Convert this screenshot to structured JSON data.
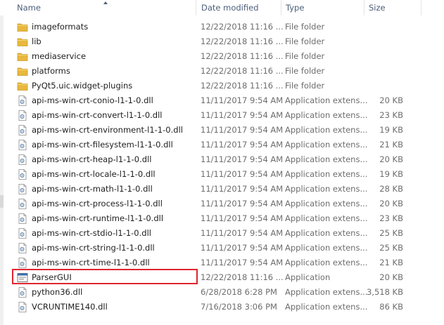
{
  "columns": {
    "name": "Name",
    "date": "Date modified",
    "type": "Type",
    "size": "Size"
  },
  "accent_colors": {
    "header_text": "#4c607a",
    "folder": "#e8b83e",
    "highlight_box": "#e0252f"
  },
  "files": [
    {
      "name": "imageformats",
      "date": "12/22/2018 11:16 ...",
      "type": "File folder",
      "size": "",
      "icon": "folder-icon"
    },
    {
      "name": "lib",
      "date": "12/22/2018 11:16 ...",
      "type": "File folder",
      "size": "",
      "icon": "folder-icon"
    },
    {
      "name": "mediaservice",
      "date": "12/22/2018 11:16 ...",
      "type": "File folder",
      "size": "",
      "icon": "folder-icon"
    },
    {
      "name": "platforms",
      "date": "12/22/2018 11:16 ...",
      "type": "File folder",
      "size": "",
      "icon": "folder-icon"
    },
    {
      "name": "PyQt5.uic.widget-plugins",
      "date": "12/22/2018 11:16 ...",
      "type": "File folder",
      "size": "",
      "icon": "folder-icon"
    },
    {
      "name": "api-ms-win-crt-conio-l1-1-0.dll",
      "date": "11/11/2017 9:54 AM",
      "type": "Application extens...",
      "size": "20 KB",
      "icon": "dll-icon"
    },
    {
      "name": "api-ms-win-crt-convert-l1-1-0.dll",
      "date": "11/11/2017 9:54 AM",
      "type": "Application extens...",
      "size": "23 KB",
      "icon": "dll-icon"
    },
    {
      "name": "api-ms-win-crt-environment-l1-1-0.dll",
      "date": "11/11/2017 9:54 AM",
      "type": "Application extens...",
      "size": "19 KB",
      "icon": "dll-icon"
    },
    {
      "name": "api-ms-win-crt-filesystem-l1-1-0.dll",
      "date": "11/11/2017 9:54 AM",
      "type": "Application extens...",
      "size": "21 KB",
      "icon": "dll-icon"
    },
    {
      "name": "api-ms-win-crt-heap-l1-1-0.dll",
      "date": "11/11/2017 9:54 AM",
      "type": "Application extens...",
      "size": "20 KB",
      "icon": "dll-icon"
    },
    {
      "name": "api-ms-win-crt-locale-l1-1-0.dll",
      "date": "11/11/2017 9:54 AM",
      "type": "Application extens...",
      "size": "19 KB",
      "icon": "dll-icon"
    },
    {
      "name": "api-ms-win-crt-math-l1-1-0.dll",
      "date": "11/11/2017 9:54 AM",
      "type": "Application extens...",
      "size": "28 KB",
      "icon": "dll-icon"
    },
    {
      "name": "api-ms-win-crt-process-l1-1-0.dll",
      "date": "11/11/2017 9:54 AM",
      "type": "Application extens...",
      "size": "20 KB",
      "icon": "dll-icon"
    },
    {
      "name": "api-ms-win-crt-runtime-l1-1-0.dll",
      "date": "11/11/2017 9:54 AM",
      "type": "Application extens...",
      "size": "23 KB",
      "icon": "dll-icon"
    },
    {
      "name": "api-ms-win-crt-stdio-l1-1-0.dll",
      "date": "11/11/2017 9:54 AM",
      "type": "Application extens...",
      "size": "25 KB",
      "icon": "dll-icon"
    },
    {
      "name": "api-ms-win-crt-string-l1-1-0.dll",
      "date": "11/11/2017 9:54 AM",
      "type": "Application extens...",
      "size": "25 KB",
      "icon": "dll-icon"
    },
    {
      "name": "api-ms-win-crt-time-l1-1-0.dll",
      "date": "11/11/2017 9:54 AM",
      "type": "Application extens...",
      "size": "21 KB",
      "icon": "dll-icon"
    },
    {
      "name": "ParserGUI",
      "date": "12/22/2018 11:16 ...",
      "type": "Application",
      "size": "20 KB",
      "icon": "application-icon",
      "highlighted": true
    },
    {
      "name": "python36.dll",
      "date": "6/28/2018 6:28 PM",
      "type": "Application extens...",
      "size": "3,518 KB",
      "icon": "dll-icon"
    },
    {
      "name": "VCRUNTIME140.dll",
      "date": "7/16/2018 3:06 PM",
      "type": "Application extens...",
      "size": "86 KB",
      "icon": "dll-icon"
    }
  ]
}
